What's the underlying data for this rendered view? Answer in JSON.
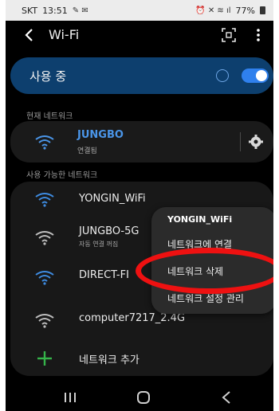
{
  "status_bar": {
    "carrier": "SKT",
    "time": "13:51",
    "battery": "77%"
  },
  "app_bar": {
    "title": "Wi-Fi"
  },
  "wifi_toggle": {
    "label": "사용 중",
    "on": true
  },
  "current_network": {
    "section_label": "현재 네트워크",
    "name": "JUNGBO",
    "status": "연결됨"
  },
  "available": {
    "section_label": "사용 가능한 네트워크",
    "networks": [
      {
        "name": "YONGIN_WiFi",
        "sub": ""
      },
      {
        "name": "JUNGBO-5G",
        "sub": "자동 연결 꺼짐"
      },
      {
        "name": "DIRECT-FI",
        "sub": ""
      },
      {
        "name": "computer7217_2.4G",
        "sub": ""
      }
    ],
    "add_label": "네트워크 추가"
  },
  "context_menu": {
    "title": "YONGIN_WiFi",
    "items": [
      "네트워크에 연결",
      "네트워크 삭제",
      "네트워크 설정 관리"
    ]
  },
  "colors": {
    "accent": "#2f80ed",
    "highlight_circle": "#ee1111",
    "add_plus": "#35b44a"
  },
  "icons": {
    "back": "arrow-left-icon",
    "scan": "qr-scan-icon",
    "more": "more-vertical-icon",
    "wifi": "wifi-icon",
    "settings": "gear-icon",
    "add": "plus-icon"
  }
}
